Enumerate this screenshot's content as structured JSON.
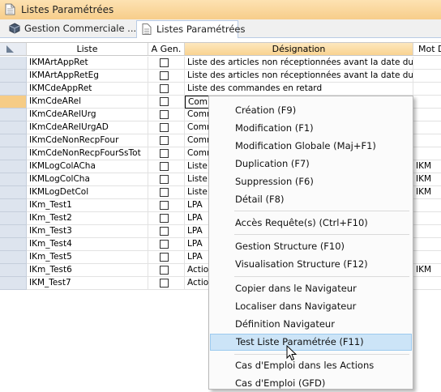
{
  "window": {
    "title": "Listes Paramétrées"
  },
  "tabs": [
    {
      "label": "Gestion Commerciale ..."
    },
    {
      "label": "Listes Paramétrées"
    }
  ],
  "grid": {
    "columns": {
      "liste": "Liste",
      "agen": "A Gen.",
      "designation": "Désignation",
      "mot": "Mot D"
    },
    "rows": [
      {
        "liste": "IKMArtAppRet",
        "designation": "Liste des articles non réceptionnées avant la date du jour",
        "mot": ""
      },
      {
        "liste": "IKMArtAppRetEg",
        "designation": "Liste des articles non réceptionnées avant la date du jour",
        "mot": ""
      },
      {
        "liste": "IKMCdeAppRet",
        "designation": "Liste des commandes en retard",
        "mot": ""
      },
      {
        "liste": "IKmCdeARel",
        "designation": "Comm",
        "mot": ""
      },
      {
        "liste": "IKmCdeARelUrg",
        "designation": "Comm",
        "mot": ""
      },
      {
        "liste": "IKmCdeARelUrgAD",
        "designation": "Comm",
        "mot": ""
      },
      {
        "liste": "IKmCdeNonRecpFour",
        "designation": "Comm",
        "mot": ""
      },
      {
        "liste": "IKmCdeNonRecpFourSsTot",
        "designation": "Comm",
        "mot": ""
      },
      {
        "liste": "IKMLogColACha",
        "designation": "Liste",
        "mot": "IKM"
      },
      {
        "liste": "IKMLogColCha",
        "designation": "Liste",
        "mot": "IKM"
      },
      {
        "liste": "IKMLogDetCol",
        "designation": "Liste",
        "mot": "IKM"
      },
      {
        "liste": "IKm_Test1",
        "designation": "LPA",
        "mot": ""
      },
      {
        "liste": "IKm_Test2",
        "designation": "LPA",
        "mot": ""
      },
      {
        "liste": "IKm_Test3",
        "designation": "LPA",
        "mot": ""
      },
      {
        "liste": "IKm_Test4",
        "designation": "LPA",
        "mot": ""
      },
      {
        "liste": "IKm_Test5",
        "designation": "LPA",
        "mot": ""
      },
      {
        "liste": "IKm_Test6",
        "designation": "Action",
        "mot": "IKM"
      },
      {
        "liste": "IKM_Test7",
        "designation": "Action",
        "mot": ""
      }
    ]
  },
  "context_menu": {
    "items": [
      "Création (F9)",
      "Modification (F1)",
      "Modification Globale (Maj+F1)",
      "Duplication (F7)",
      "Suppression (F6)",
      "Détail (F8)",
      "Accès Requête(s) (Ctrl+F10)",
      "Gestion Structure (F10)",
      "Visualisation Structure (F12)",
      "Copier dans le Navigateur",
      "Localiser dans Navigateur",
      "Définition Navigateur",
      "Test Liste Paramétrée (F11)",
      "Cas d'Emploi dans les Actions",
      "Cas d'Emploi (GFD)"
    ],
    "highlighted": "Test Liste Paramétrée (F11)"
  },
  "colors": {
    "accent": "#f7cd8a",
    "selection": "#cce4f7"
  }
}
